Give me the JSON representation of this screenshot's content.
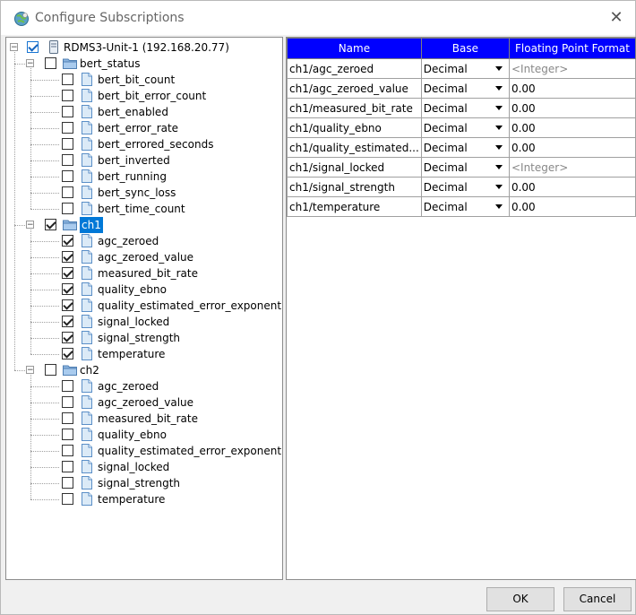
{
  "window": {
    "title": "Configure Subscriptions",
    "close_glyph": "✕"
  },
  "tree": {
    "root": {
      "label": "RDMS3-Unit-1 (192.168.20.77)",
      "checked": true,
      "icon": "server-icon"
    },
    "groups": [
      {
        "name": "bert_status",
        "checked": false,
        "selected": false,
        "items": [
          {
            "label": "bert_bit_count",
            "checked": false
          },
          {
            "label": "bert_bit_error_count",
            "checked": false
          },
          {
            "label": "bert_enabled",
            "checked": false
          },
          {
            "label": "bert_error_rate",
            "checked": false
          },
          {
            "label": "bert_errored_seconds",
            "checked": false
          },
          {
            "label": "bert_inverted",
            "checked": false
          },
          {
            "label": "bert_running",
            "checked": false
          },
          {
            "label": "bert_sync_loss",
            "checked": false
          },
          {
            "label": "bert_time_count",
            "checked": false
          }
        ]
      },
      {
        "name": "ch1",
        "checked": true,
        "selected": true,
        "items": [
          {
            "label": "agc_zeroed",
            "checked": true
          },
          {
            "label": "agc_zeroed_value",
            "checked": true
          },
          {
            "label": "measured_bit_rate",
            "checked": true
          },
          {
            "label": "quality_ebno",
            "checked": true
          },
          {
            "label": "quality_estimated_error_exponent",
            "checked": true
          },
          {
            "label": "signal_locked",
            "checked": true
          },
          {
            "label": "signal_strength",
            "checked": true
          },
          {
            "label": "temperature",
            "checked": true
          }
        ]
      },
      {
        "name": "ch2",
        "checked": false,
        "selected": false,
        "items": [
          {
            "label": "agc_zeroed",
            "checked": false
          },
          {
            "label": "agc_zeroed_value",
            "checked": false
          },
          {
            "label": "measured_bit_rate",
            "checked": false
          },
          {
            "label": "quality_ebno",
            "checked": false
          },
          {
            "label": "quality_estimated_error_exponent",
            "checked": false
          },
          {
            "label": "signal_locked",
            "checked": false
          },
          {
            "label": "signal_strength",
            "checked": false
          },
          {
            "label": "temperature",
            "checked": false
          }
        ]
      }
    ]
  },
  "grid": {
    "columns": [
      "Name",
      "Base",
      "Floating Point Format"
    ],
    "header_color": "#0000ff",
    "rows": [
      {
        "name": "ch1/agc_zeroed",
        "base": "Decimal",
        "format": "<Integer>",
        "placeholder": true
      },
      {
        "name": "ch1/agc_zeroed_value",
        "base": "Decimal",
        "format": "0.00",
        "placeholder": false
      },
      {
        "name": "ch1/measured_bit_rate",
        "base": "Decimal",
        "format": "0.00",
        "placeholder": false
      },
      {
        "name": "ch1/quality_ebno",
        "base": "Decimal",
        "format": "0.00",
        "placeholder": false
      },
      {
        "name": "ch1/quality_estimated...",
        "base": "Decimal",
        "format": "0.00",
        "placeholder": false
      },
      {
        "name": "ch1/signal_locked",
        "base": "Decimal",
        "format": "<Integer>",
        "placeholder": true
      },
      {
        "name": "ch1/signal_strength",
        "base": "Decimal",
        "format": "0.00",
        "placeholder": false
      },
      {
        "name": "ch1/temperature",
        "base": "Decimal",
        "format": "0.00",
        "placeholder": false
      }
    ]
  },
  "buttons": {
    "ok": "OK",
    "cancel": "Cancel"
  }
}
